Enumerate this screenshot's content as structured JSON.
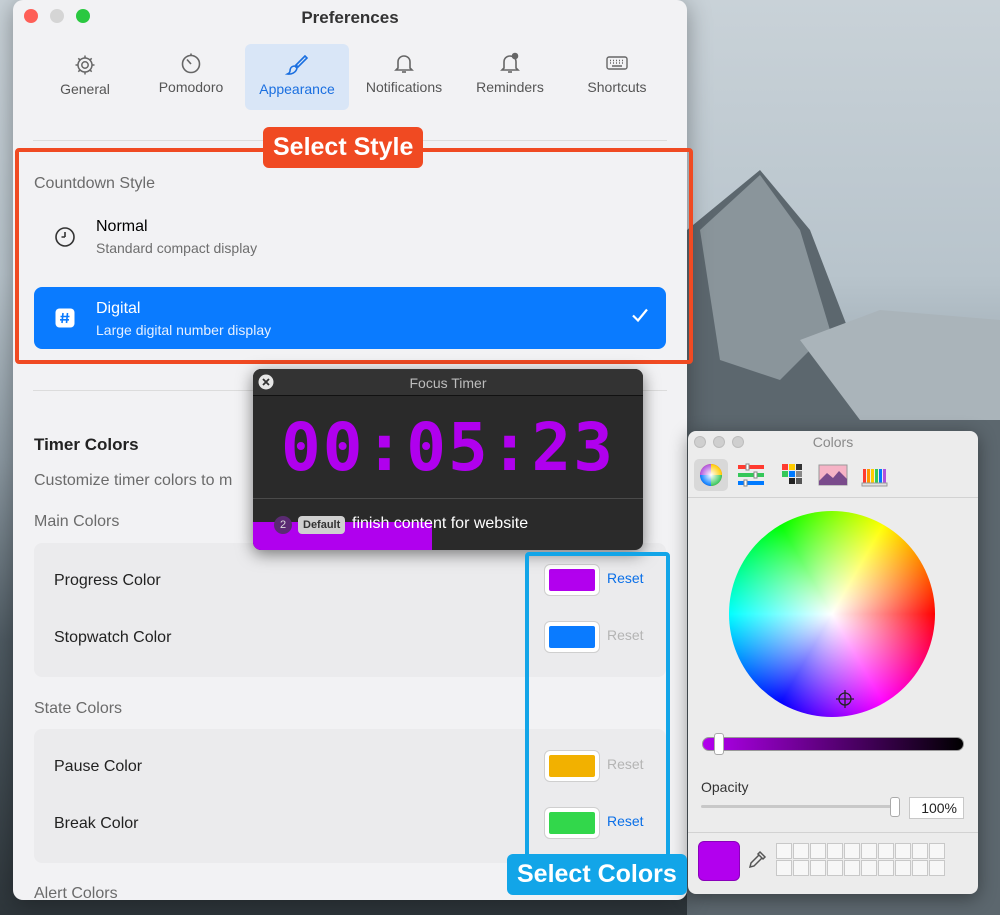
{
  "prefs": {
    "title": "Preferences",
    "tabs": [
      {
        "label": "General",
        "icon": "gear-icon"
      },
      {
        "label": "Pomodoro",
        "icon": "timer-icon"
      },
      {
        "label": "Appearance",
        "icon": "paintbrush-icon"
      },
      {
        "label": "Notifications",
        "icon": "bell-icon"
      },
      {
        "label": "Reminders",
        "icon": "bell-badge-icon"
      },
      {
        "label": "Shortcuts",
        "icon": "keyboard-icon"
      }
    ],
    "active_tab": "Appearance",
    "countdown": {
      "label": "Countdown Style",
      "options": [
        {
          "title": "Normal",
          "subtitle": "Standard compact display"
        },
        {
          "title": "Digital",
          "subtitle": "Large digital number display"
        }
      ],
      "selected": "Digital"
    },
    "timer_colors": {
      "heading": "Timer Colors",
      "description": "Customize timer colors to m",
      "main_label": "Main Colors",
      "state_label": "State Colors",
      "alert_label": "Alert Colors",
      "rows": [
        {
          "label": "Progress Color",
          "color": "#b200ee",
          "reset": "Reset",
          "reset_enabled": true
        },
        {
          "label": "Stopwatch Color",
          "color": "#0a7bff",
          "reset": "Reset",
          "reset_enabled": false
        },
        {
          "label": "Pause Color",
          "color": "#f2b100",
          "reset": "Reset",
          "reset_enabled": false
        },
        {
          "label": "Break Color",
          "color": "#32d74b",
          "reset": "Reset",
          "reset_enabled": true
        }
      ]
    }
  },
  "annotations": {
    "style_tag": "Select Style",
    "colors_tag": "Select Colors"
  },
  "timer": {
    "title": "Focus Timer",
    "time": "00:05:23",
    "task_count": "2",
    "task_tag": "Default",
    "task_text": "finish content for website",
    "progress": 0.46,
    "accent": "#b000ee"
  },
  "colors_panel": {
    "title": "Colors",
    "opacity_label": "Opacity",
    "opacity_value": "100%",
    "opacity": 1.0,
    "current_color": "#b200ee"
  }
}
